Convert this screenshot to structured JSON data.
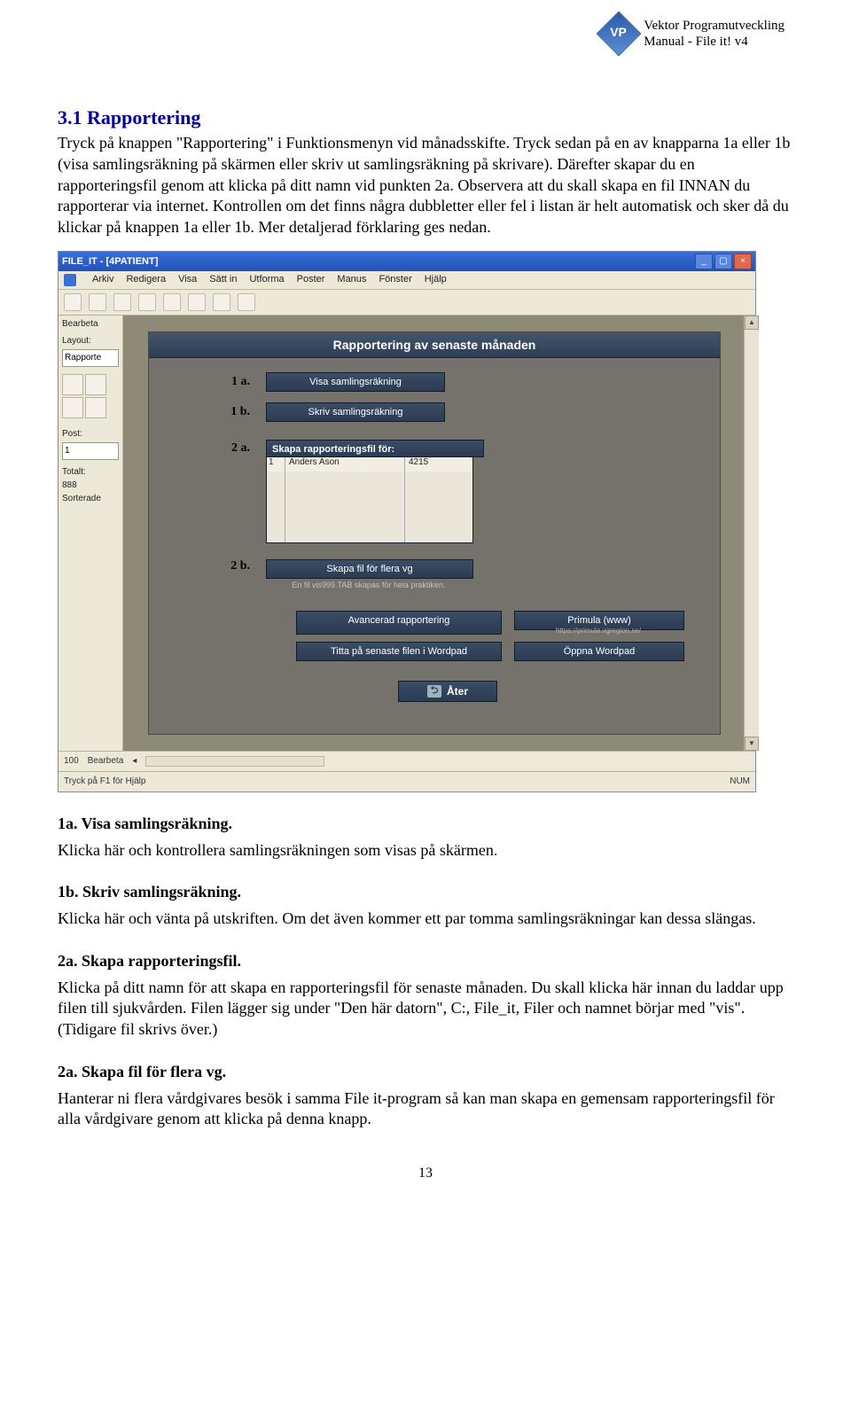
{
  "header": {
    "company": "Vektor Programutveckling",
    "manual": "Manual - File it! v4",
    "logo_text": "VP"
  },
  "section_heading": "3.1 Rapportering",
  "intro_paragraph": "Tryck på knappen \"Rapportering\" i Funktionsmenyn vid månadsskifte. Tryck sedan på en av knapparna 1a eller 1b (visa samlingsräkning på skärmen eller skriv ut samlingsräkning på skrivare). Därefter skapar du en rapporteringsfil genom att klicka på ditt namn vid punkten 2a. Observera att du skall skapa en fil INNAN du rapporterar via internet. Kontrollen om det finns några dubbletter eller fel i listan är helt automatisk och sker då du klickar på knappen 1a eller 1b. Mer detaljerad förklaring ges nedan.",
  "screenshot": {
    "title": "FILE_IT - [4PATIENT]",
    "menus": [
      "Arkiv",
      "Redigera",
      "Visa",
      "Sätt in",
      "Utforma",
      "Poster",
      "Manus",
      "Fönster",
      "Hjälp"
    ],
    "sidebar": {
      "bearbeta": "Bearbeta",
      "layout_label": "Layout:",
      "layout_value": "Rapporte",
      "post_label": "Post:",
      "post_value": "1",
      "totalt_label": "Totalt:",
      "totalt_value": "888",
      "sorterade": "Sorterade"
    },
    "panel_title": "Rapportering av senaste månaden",
    "rows": {
      "r1a": "1 a.",
      "btn1a": "Visa samlingsräkning",
      "r1b": "1 b.",
      "btn1b": "Skriv samlingsräkning",
      "r2a": "2 a.",
      "list_header": "Skapa rapporteringsfil för:",
      "list_item_no": "1",
      "list_item_name": "Anders Ason",
      "list_item_code": "4215",
      "r2b": "2 b.",
      "btn2b": "Skapa fil för flera vg",
      "hint2b": "En fil vis999.TAB skapas för hela praktiken."
    },
    "grid": {
      "adv": "Avancerad rapportering",
      "primula": "Primula (www)",
      "primula_url": "https://primula.vgregion.se/",
      "titta": "Titta på senaste filen i  Wordpad",
      "oppna": "Öppna Wordpad"
    },
    "back": "Åter",
    "statusbar": {
      "zoom": "100",
      "mode": "Bearbeta",
      "help": "Tryck på F1 för Hjälp",
      "num": "NUM"
    }
  },
  "s1a_head": "1a. Visa samlingsräkning.",
  "s1a_body": "Klicka här och kontrollera samlingsräkningen som visas på skärmen.",
  "s1b_head": "1b. Skriv samlingsräkning.",
  "s1b_body": "Klicka här och vänta på utskriften. Om det även kommer ett par tomma samlingsräkningar kan dessa slängas.",
  "s2a_head": "2a. Skapa rapporteringsfil.",
  "s2a_body": "Klicka på ditt namn för att skapa en rapporteringsfil för senaste månaden. Du skall klicka här innan du laddar upp filen till sjukvården. Filen lägger sig under \"Den här datorn\", C:, File_it, Filer och namnet börjar med \"vis\". (Tidigare fil skrivs över.)",
  "s2b_head": "2a. Skapa fil för flera vg.",
  "s2b_body": "Hanterar ni flera vårdgivares besök i samma File it-program så kan man skapa en gemensam rapporteringsfil för alla vårdgivare genom att klicka på denna knapp.",
  "page_number": "13"
}
